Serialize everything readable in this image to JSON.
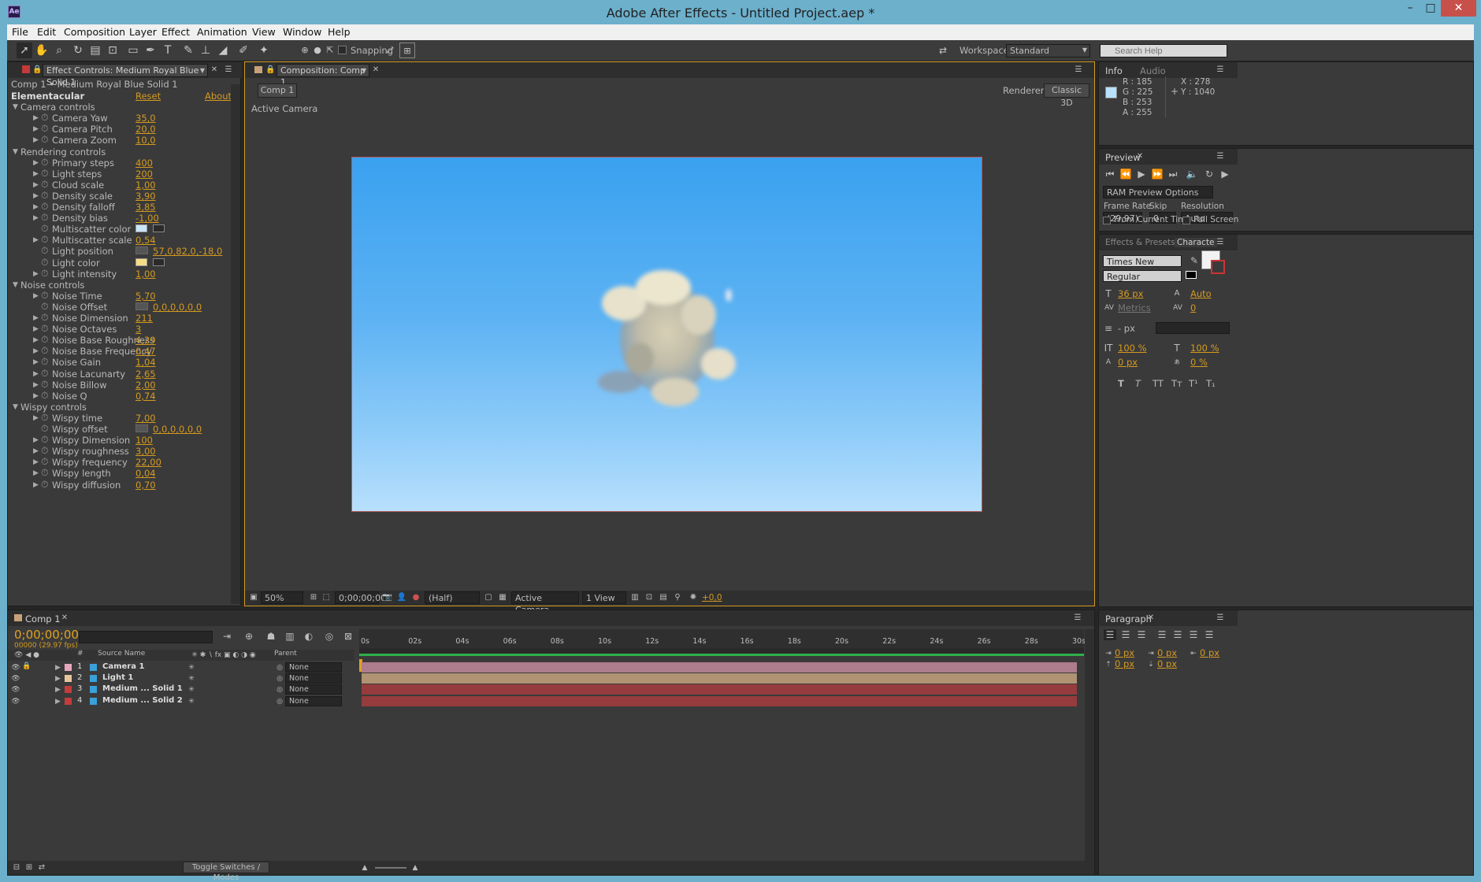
{
  "window": {
    "title": "Adobe After Effects - Untitled Project.aep *",
    "logo": "Ae",
    "min": "–",
    "max": "□",
    "close": "✕"
  },
  "menu": [
    "File",
    "Edit",
    "Composition",
    "Layer",
    "Effect",
    "Animation",
    "View",
    "Window",
    "Help"
  ],
  "toolbar": {
    "snapping_label": "Snapping",
    "workspace_label": "Workspace:",
    "workspace_value": "Standard",
    "search_placeholder": "Search Help"
  },
  "effect_controls": {
    "tab_title": "Effect Controls: Medium Royal Blue Solid 1",
    "breadcrumb": "Comp 1 • Medium Royal Blue Solid 1",
    "effect_name": "Elementacular",
    "reset_label": "Reset",
    "about_label": "About...",
    "groups": [
      {
        "name": "Camera controls",
        "props": [
          {
            "label": "Camera Yaw",
            "value": "35,0"
          },
          {
            "label": "Camera Pitch",
            "value": "20,0"
          },
          {
            "label": "Camera Zoom",
            "value": "10,0"
          }
        ]
      },
      {
        "name": "Rendering controls",
        "props": [
          {
            "label": "Primary steps",
            "value": "400"
          },
          {
            "label": "Light steps",
            "value": "200"
          },
          {
            "label": "Cloud scale",
            "value": "1,00"
          },
          {
            "label": "Density scale",
            "value": "3,90"
          },
          {
            "label": "Density falloff",
            "value": "3,85"
          },
          {
            "label": "Density bias",
            "value": "-1,00"
          },
          {
            "label": "Multiscatter color",
            "value": "",
            "color": "#c9e6fb"
          },
          {
            "label": "Multiscatter scale",
            "value": "0,54"
          },
          {
            "label": "Light position",
            "value": "57,0,82,0,-18,0",
            "point": true
          },
          {
            "label": "Light color",
            "value": "",
            "color": "#f5dc85"
          },
          {
            "label": "Light intensity",
            "value": "1,00"
          }
        ]
      },
      {
        "name": "Noise controls",
        "props": [
          {
            "label": "Noise Time",
            "value": "5,70"
          },
          {
            "label": "Noise Offset",
            "value": "0,0,0,0,0,0",
            "point": true
          },
          {
            "label": "Noise Dimension",
            "value": "211"
          },
          {
            "label": "Noise Octaves",
            "value": "3"
          },
          {
            "label": "Noise Base Roughness",
            "value": "4,29"
          },
          {
            "label": "Noise Base Frequency",
            "value": "0,47"
          },
          {
            "label": "Noise Gain",
            "value": "1,04"
          },
          {
            "label": "Noise Lacunarty",
            "value": "2,65"
          },
          {
            "label": "Noise Billow",
            "value": "2,00"
          },
          {
            "label": "Noise Q",
            "value": "0,74"
          }
        ]
      },
      {
        "name": "Wispy controls",
        "props": [
          {
            "label": "Wispy time",
            "value": "7,00"
          },
          {
            "label": "Wispy offset",
            "value": "0,0,0,0,0,0",
            "point": true
          },
          {
            "label": "Wispy Dimension",
            "value": "100"
          },
          {
            "label": "Wispy roughness",
            "value": "3,00"
          },
          {
            "label": "Wispy frequency",
            "value": "22,00"
          },
          {
            "label": "Wispy length",
            "value": "0,04"
          },
          {
            "label": "Wispy diffusion",
            "value": "0,70"
          }
        ]
      }
    ]
  },
  "composition": {
    "tab_title": "Composition: Comp 1",
    "comp_button": "Comp 1",
    "renderer_label": "Renderer:",
    "renderer_value": "Classic 3D",
    "view_label": "Active Camera",
    "footer": {
      "zoom": "50%",
      "timecode": "0;00;00;00",
      "resolution": "(Half)",
      "camera": "Active Camera",
      "views": "1 View",
      "exposure": "+0,0"
    }
  },
  "info": {
    "tabs": [
      "Info",
      "Audio"
    ],
    "r": "R : 185",
    "g": "G : 225",
    "b": "B : 253",
    "a": "A : 255",
    "x": "X : 278",
    "y": "Y : 1040",
    "swatch": "#b9e1fd"
  },
  "preview": {
    "tab": "Preview",
    "ram_options": "RAM Preview Options",
    "frame_rate_label": "Frame Rate",
    "skip_label": "Skip",
    "resolution_label": "Resolution",
    "frame_rate": "(29,97)",
    "skip": "0",
    "resolution": "Auto",
    "from_current": "From Current Time",
    "full_screen": "Full Screen"
  },
  "character": {
    "tabs": [
      "Effects & Presets",
      "Characte"
    ],
    "font": "Times New Roman",
    "style": "Regular",
    "size": "36 px",
    "leading": "Auto",
    "kerning": "Metrics",
    "tracking": "0",
    "stroke": "- px",
    "vscale": "100 %",
    "hscale": "100 %",
    "baseline": "0 px",
    "tsume": "0 %",
    "styles": [
      "T",
      "T",
      "TT",
      "Tт",
      "T¹",
      "T₁"
    ]
  },
  "paragraph": {
    "tab": "Paragraph",
    "indent_left": "0 px",
    "indent_first": "0 px",
    "indent_right": "0 px",
    "space_before": "0 px",
    "space_after": "0 px"
  },
  "timeline": {
    "tab": "Comp 1",
    "timecode": "0;00;00;00",
    "fps": "00000 (29.97 fps)",
    "columns": {
      "num": "#",
      "source": "Source Name",
      "parent": "Parent"
    },
    "ruler": [
      "0s",
      "02s",
      "04s",
      "06s",
      "08s",
      "10s",
      "12s",
      "14s",
      "16s",
      "18s",
      "20s",
      "22s",
      "24s",
      "26s",
      "28s",
      "30s"
    ],
    "layers": [
      {
        "num": "1",
        "name": "Camera 1",
        "parent": "None",
        "label": "#e7a7bb",
        "bar": "#ad7c8d"
      },
      {
        "num": "2",
        "name": "Light 1",
        "parent": "None",
        "label": "#e8c49d",
        "bar": "#b09372"
      },
      {
        "num": "3",
        "name": "Medium ... Solid 1",
        "parent": "None",
        "label": "#c43c3c",
        "bar": "#963c3e"
      },
      {
        "num": "4",
        "name": "Medium ... Solid 2",
        "parent": "None",
        "label": "#c43c3c",
        "bar": "#963c3e"
      }
    ],
    "toggle_label": "Toggle Switches / Modes"
  }
}
